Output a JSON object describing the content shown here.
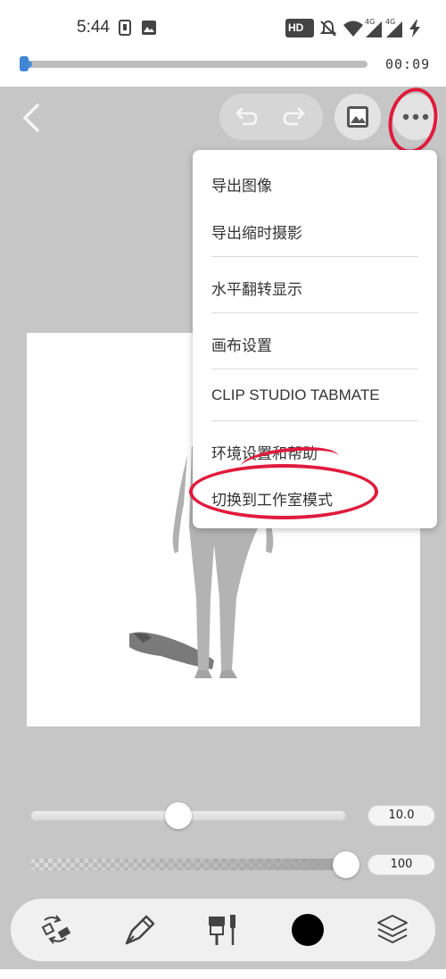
{
  "status_bar": {
    "time": "5:44",
    "hd_badge": "HD",
    "network_label_1": "4G",
    "network_label_2": "4G",
    "icons": [
      "sim-icon",
      "gallery-icon",
      "hd-voice-icon",
      "mute-icon",
      "wifi-icon",
      "signal-4g-icon",
      "signal-4g-icon",
      "charging-icon"
    ]
  },
  "video_player": {
    "elapsed": "00:09",
    "progress_fraction": 0.03
  },
  "toolbar": {
    "icons": [
      "back-icon",
      "undo-icon",
      "redo-icon",
      "image-icon",
      "more-icon"
    ]
  },
  "menu": {
    "items": [
      {
        "label": "导出图像"
      },
      {
        "label": "导出缩时摄影"
      },
      {
        "label": "水平翻转显示"
      },
      {
        "label": "画布设置"
      },
      {
        "label": "CLIP STUDIO TABMATE"
      },
      {
        "label": "环境设置和帮助"
      },
      {
        "label": "切换到工作室模式"
      }
    ]
  },
  "sliders": {
    "brush_size": {
      "value": "10.0",
      "fraction": 0.47
    },
    "opacity": {
      "value": "100",
      "fraction": 1.0
    }
  },
  "bottom_toolbar": {
    "icons": [
      "tool-switch-icon",
      "pen-icon",
      "brush-palette-icon",
      "color-swatch",
      "layers-icon"
    ],
    "current_color": "#000000"
  },
  "colors": {
    "annotation": "#e01b3c",
    "accent": "#4a90d9",
    "background": "#c6c6c6"
  }
}
